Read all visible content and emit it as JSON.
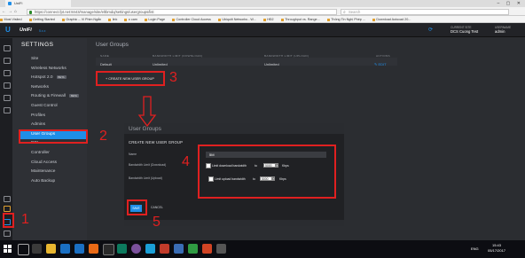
{
  "browser": {
    "tab_title": "UniFi",
    "url": "https://connect.fpt.net:8443/manage/site/eltbmdq/settings/usergroups/list",
    "search_placeholder": "Search",
    "nav_icons": [
      "back-icon",
      "forward-icon",
      "home-icon"
    ],
    "bookmarks": [
      "Most Visited",
      "Getting Started",
      "Graphic -- Vi Phim Ngắn",
      "link",
      "o cam",
      "Login Page",
      "Controller Cloud Access",
      "Ubiquiti Networks - W...",
      "HĐ2",
      "Throughput vs. Range...",
      "Thông Tin Nghị Phép ...",
      "Download Autocad 20..."
    ]
  },
  "header": {
    "logo_text": "U",
    "brand": "UniFi",
    "version": "5.x.x",
    "site_label": "CURRENT SITE",
    "site_name": "DCS Cuong Test",
    "user_label": "USERNAME",
    "user_name": "admin"
  },
  "sidebar": {
    "title": "SETTINGS",
    "items": [
      {
        "label": "Site",
        "badge": ""
      },
      {
        "label": "Wireless Networks",
        "badge": ""
      },
      {
        "label": "Hotspot 2.0",
        "badge": "BETA"
      },
      {
        "label": "Networks",
        "badge": ""
      },
      {
        "label": "Routing & Firewall",
        "badge": "BETA"
      },
      {
        "label": "Guest Control",
        "badge": ""
      },
      {
        "label": "Profiles",
        "badge": ""
      },
      {
        "label": "Admins",
        "badge": ""
      },
      {
        "label": "User Groups",
        "badge": ""
      },
      {
        "label": "DPI",
        "badge": ""
      },
      {
        "label": "Controller",
        "badge": ""
      },
      {
        "label": "Cloud Access",
        "badge": ""
      },
      {
        "label": "Maintenance",
        "badge": ""
      },
      {
        "label": "Auto Backup",
        "badge": ""
      }
    ],
    "active_index": 8
  },
  "main": {
    "title": "User Groups",
    "table": {
      "headers": [
        "NAME",
        "BANDWIDTH LIMIT (DOWNLOAD)",
        "BANDWIDTH LIMIT (UPLOAD)",
        "ACTIONS"
      ],
      "rows": [
        {
          "name": "Default",
          "download": "Unlimited",
          "upload": "Unlimited",
          "action": "EDIT"
        }
      ]
    },
    "create_button": "CREATE NEW USER GROUP"
  },
  "modal": {
    "title": "User Groups",
    "form_title": "CREATE NEW USER GROUP",
    "name_label": "Name",
    "name_value": "5M",
    "download_label": "Bandwidth Limit (Download)",
    "download_check_text": "Limit download bandwidth",
    "download_to": "to",
    "download_value": "5000",
    "download_unit": "Kbps",
    "upload_label": "Bandwidth Limit (Upload)",
    "upload_check_text": "Limit upload bandwidth",
    "upload_to": "to",
    "upload_value": "5000",
    "upload_unit": "Kbps",
    "save_label": "SAVE",
    "cancel_label": "CANCEL"
  },
  "annotations": [
    "1",
    "2",
    "3",
    "4",
    "5"
  ],
  "taskbar": {
    "language": "ENG",
    "time": "15:43",
    "date": "05/17/2017"
  },
  "colors": {
    "accent": "#1f8ee8",
    "annotation": "#e02020",
    "background": "#2b2d31"
  }
}
